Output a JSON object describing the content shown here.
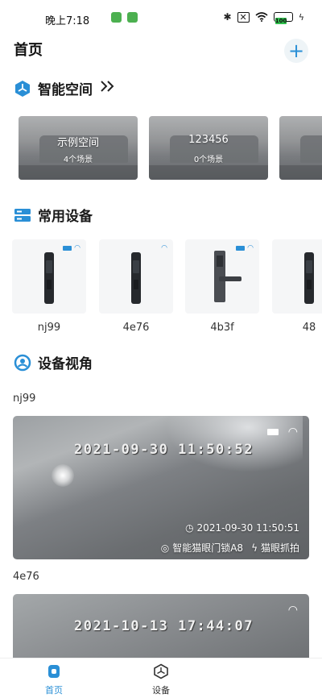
{
  "status_bar": {
    "time": "晚上7:18",
    "battery": "100"
  },
  "header": {
    "title": "首页"
  },
  "sections": {
    "spaces": {
      "title": "智能空间"
    },
    "devices": {
      "title": "常用设备"
    },
    "views": {
      "title": "设备视角"
    }
  },
  "spaces": [
    {
      "name": "示例空间",
      "scenes": "4个场景"
    },
    {
      "name": "123456",
      "scenes": "0个场景"
    }
  ],
  "devices": [
    {
      "name": "nj99"
    },
    {
      "name": "4e76"
    },
    {
      "name": "4b3f"
    },
    {
      "name": "48"
    }
  ],
  "camera_views": [
    {
      "device": "nj99",
      "osd_time": "2021-09-30  11:50:52",
      "capture_time": "2021-09-30 11:50:51",
      "model": "智能猫眼门锁A8",
      "source": "猫眼抓拍"
    },
    {
      "device": "4e76",
      "osd_time": "2021-10-13  17:44:07"
    }
  ],
  "tabs": [
    {
      "label": "首页",
      "active": true
    },
    {
      "label": "设备",
      "active": false
    }
  ],
  "colors": {
    "accent": "#2a8fd6",
    "battery": "#2fc04c"
  }
}
